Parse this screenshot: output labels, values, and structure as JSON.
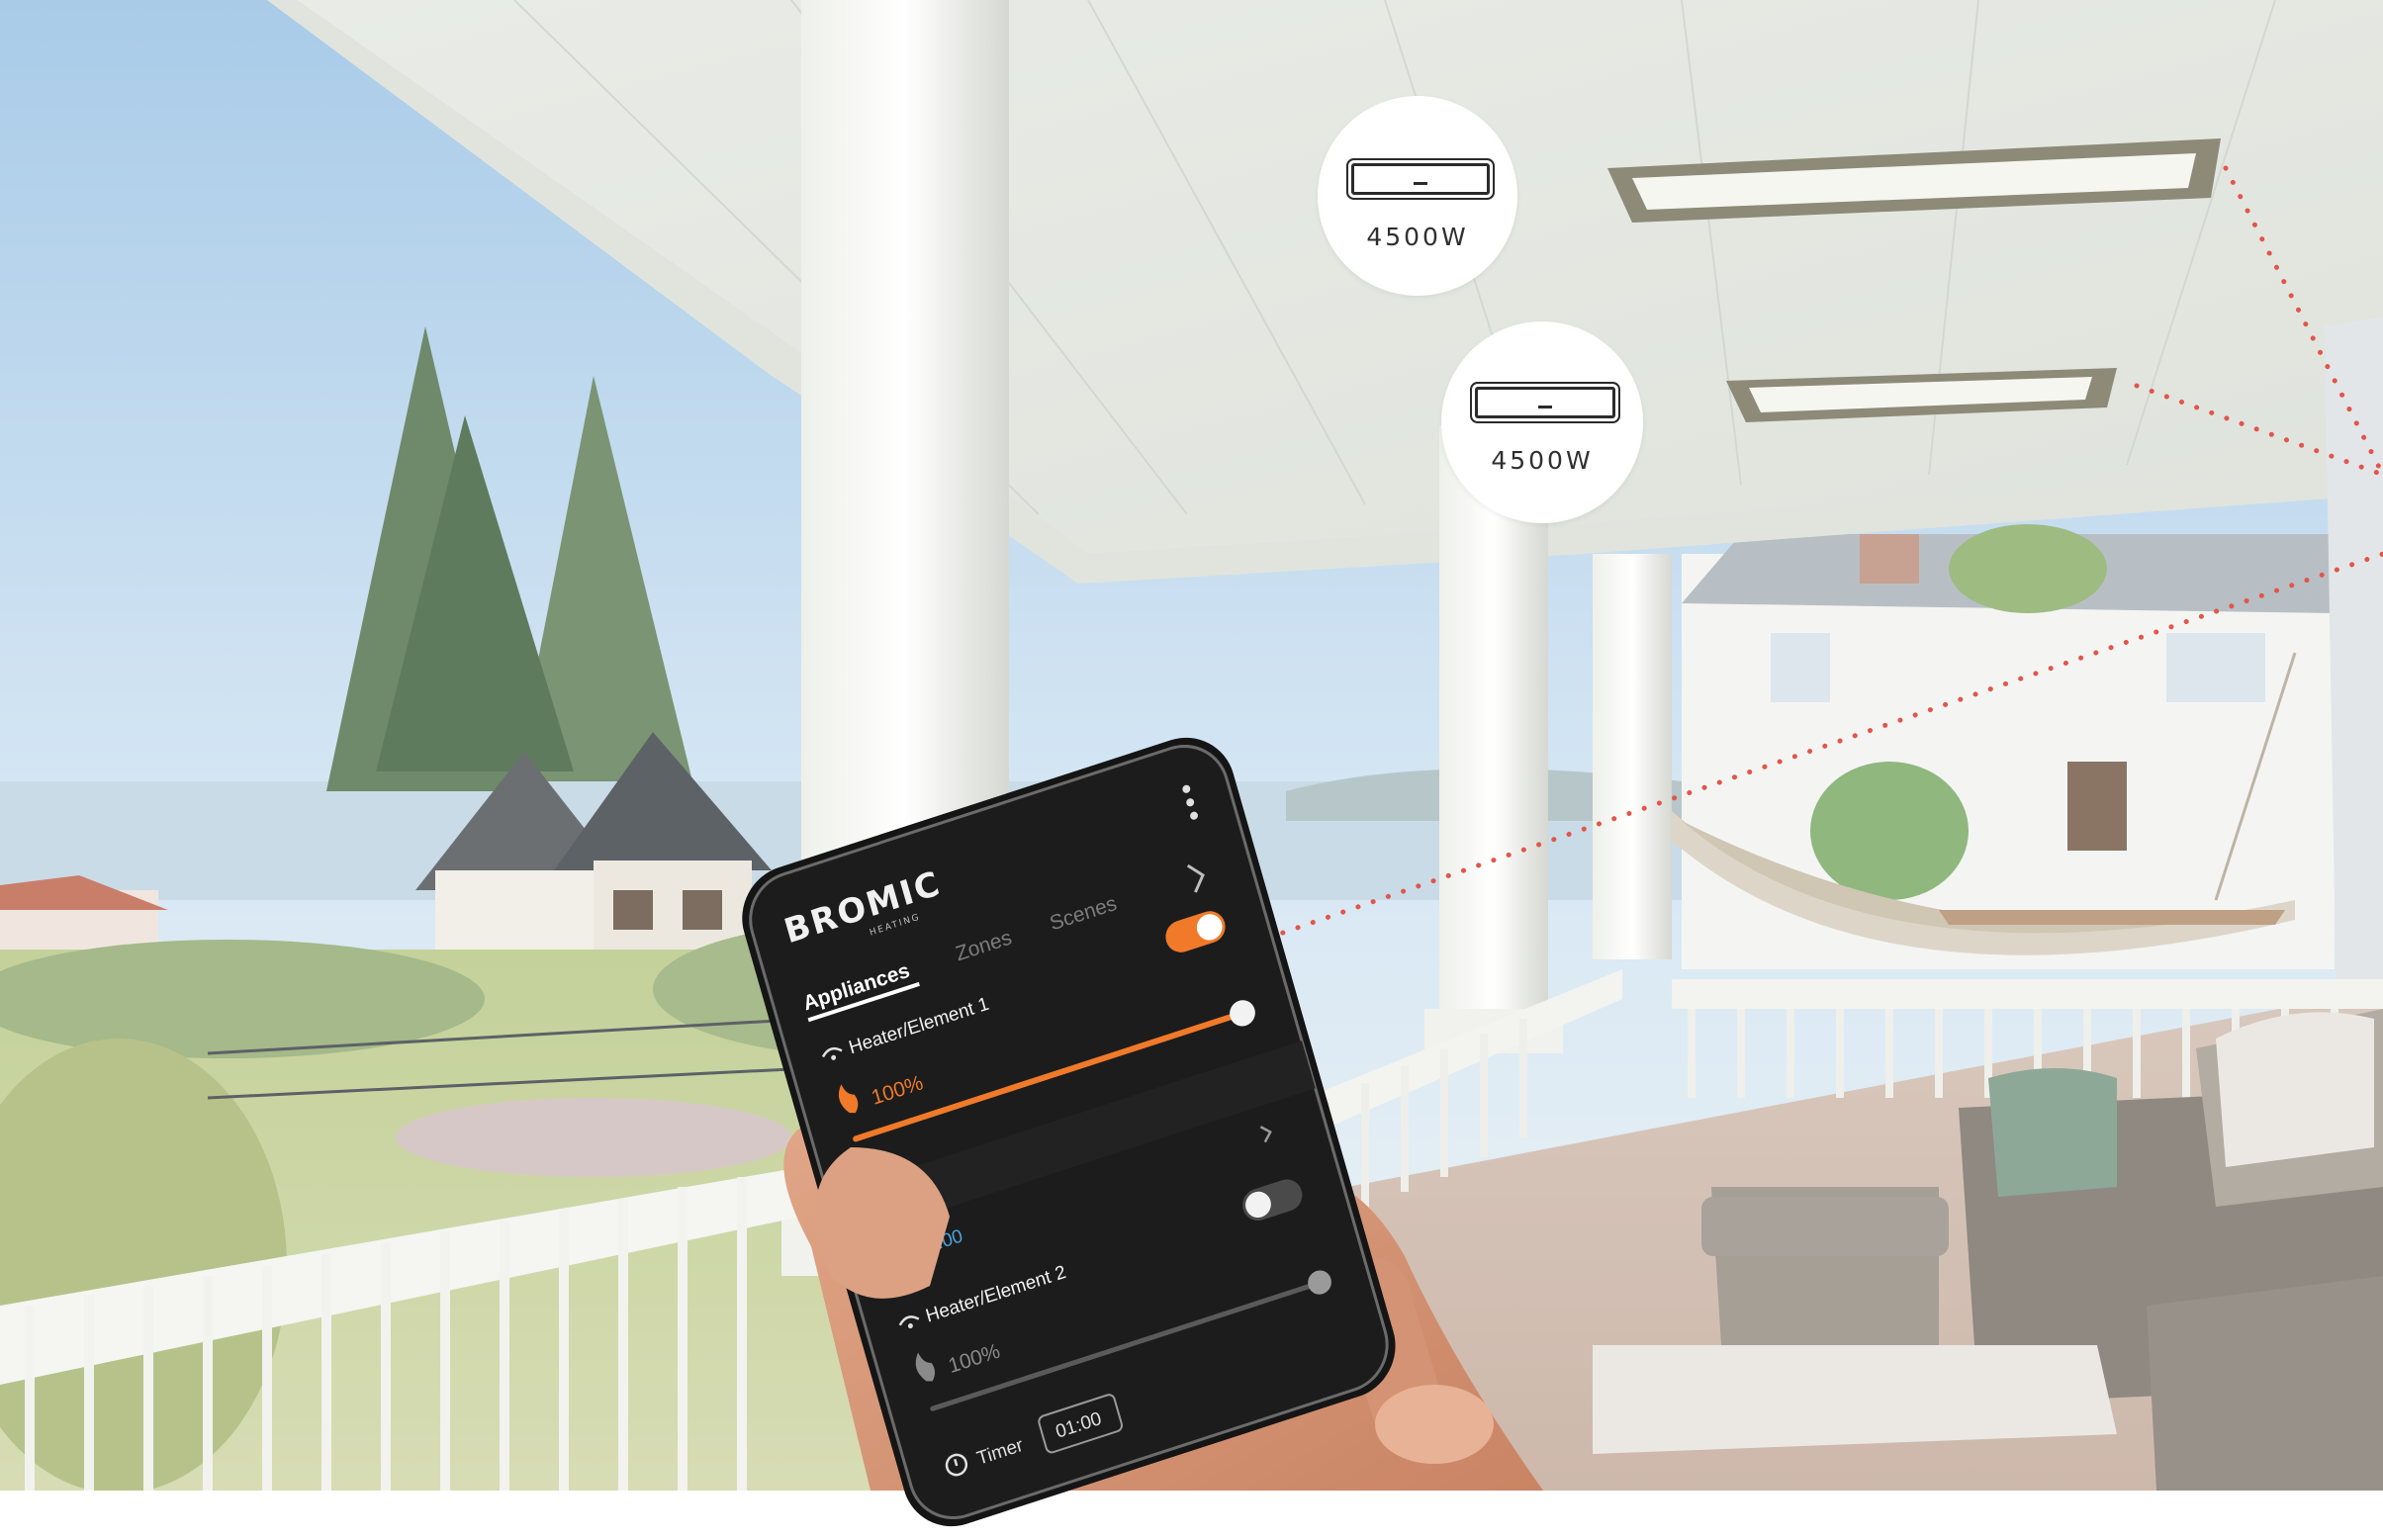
{
  "badges": [
    {
      "wattage": "4500W"
    },
    {
      "wattage": "4500W"
    }
  ],
  "app": {
    "brand": "BROMIC",
    "brand_sub": "HEATING",
    "tabs": [
      "Appliances",
      "Zones",
      "Scenes"
    ],
    "appliances": [
      {
        "name": "Heater/Element 1",
        "level": "100%",
        "on": true,
        "timer": "01:00"
      },
      {
        "name": "Heater/Element 2",
        "level": "100%",
        "on": false,
        "timer_label": "Timer",
        "timer": "01:00"
      }
    ]
  },
  "colors": {
    "accent": "#f07a2a",
    "app_bg": "#1c1c1c",
    "timer_text": "#4aa3df",
    "dotted_line": "#e2554a"
  }
}
